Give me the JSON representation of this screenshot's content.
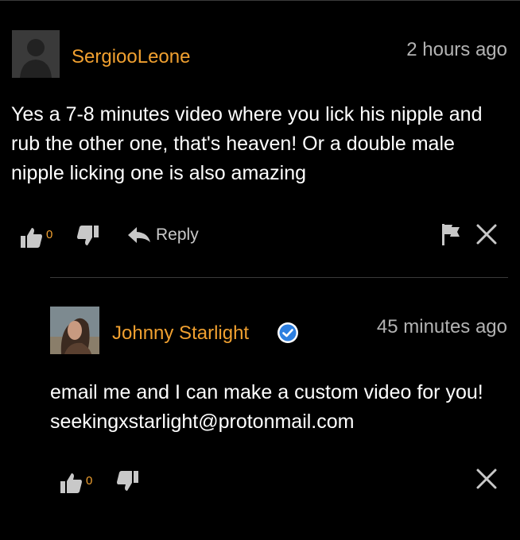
{
  "comment": {
    "username": "SergiooLeone",
    "time": "2 hours ago",
    "text": "Yes a 7-8 minutes video where you lick his nipple and rub the other one, that's heaven! Or a double male nipple licking one is also amazing",
    "likes": "0",
    "reply_label": "Reply"
  },
  "reply": {
    "username": "Johnny Starlight",
    "time": "45 minutes ago",
    "text": "email me and I can make a custom video for you! seekingxstarlight@protonmail.com",
    "likes": "0"
  },
  "colors": {
    "background": "#000000",
    "username": "#f0a030",
    "timestamp": "#b3b3b3",
    "icon": "#c8c8c8",
    "verified": "#2d7fe0"
  },
  "icons": [
    "default-avatar-icon",
    "thumbs-up-icon",
    "thumbs-down-icon",
    "reply-arrow-icon",
    "flag-icon",
    "close-icon",
    "verified-badge-icon"
  ]
}
